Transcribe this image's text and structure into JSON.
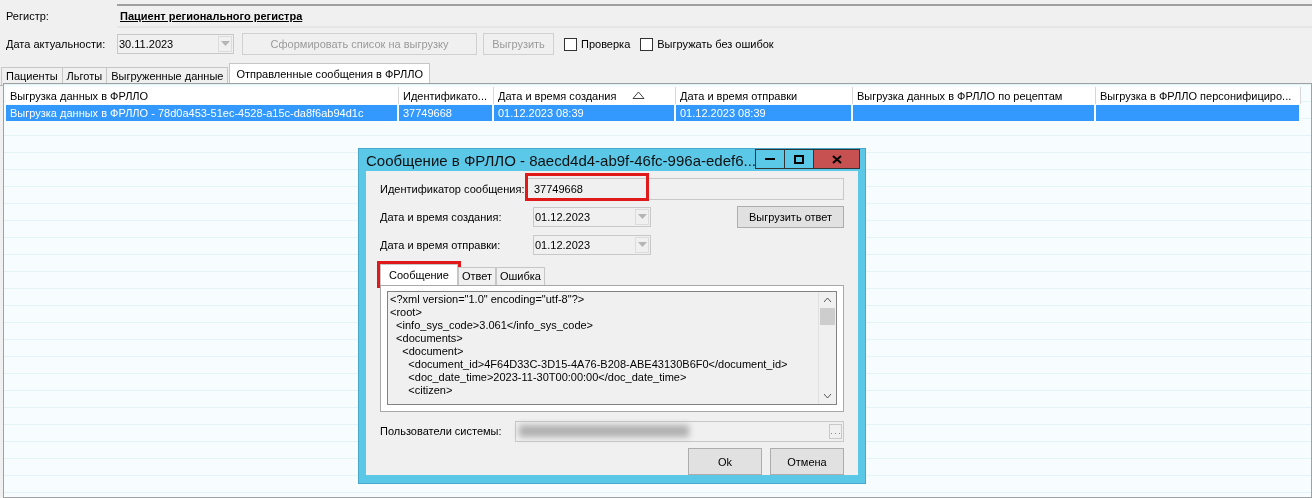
{
  "register": {
    "label": "Регистр:",
    "value": "Пациент регионального регистра"
  },
  "toolbar": {
    "date_label": "Дата актуальности:",
    "date_value": "30.11.2023",
    "buttons": [
      {
        "label": "Сформировать список на выгрузку",
        "disabled": true
      },
      {
        "label": "Выгрузить",
        "disabled": true
      }
    ],
    "checkboxes": [
      {
        "label": "Проверка",
        "checked": false
      },
      {
        "label": "Выгружать без ошибок",
        "checked": false
      }
    ]
  },
  "tabs": [
    {
      "label": "Пациенты",
      "selected": false
    },
    {
      "label": "Льготы",
      "selected": false
    },
    {
      "label": "Выгруженные данные",
      "selected": false
    },
    {
      "label": "Отправленные сообщения в ФРЛЛО",
      "selected": true
    }
  ],
  "table": {
    "columns": [
      {
        "label": "Выгрузка данных в ФРЛЛО",
        "sorted": false
      },
      {
        "label": "Идентификато...",
        "sorted": false
      },
      {
        "label": "Дата и время создания",
        "sorted": true
      },
      {
        "label": "Дата и время отправки",
        "sorted": false
      },
      {
        "label": "Выгрузка данных в ФРЛЛО по рецептам",
        "sorted": false
      },
      {
        "label": "Выгрузка в ФРЛЛО персонифициро...",
        "sorted": false
      }
    ],
    "rows": [
      {
        "selected": true,
        "cells": [
          "Выгрузка данных в ФРЛЛО - 78d0a453-51ec-4528-a15c-da8f6ab94d1c",
          "37749668",
          "01.12.2023 08:39",
          "01.12.2023 08:39",
          "",
          ""
        ]
      }
    ]
  },
  "dialog": {
    "title": "Сообщение в ФРЛЛО - 8aecd4d4-ab9f-46fc-996a-edef6...",
    "fields": [
      {
        "label": "Идентификатор сообщения:",
        "value": "37749668",
        "kind": "text",
        "highlighted": true
      },
      {
        "label": "Дата и время создания:",
        "value": "01.12.2023",
        "kind": "date",
        "highlighted": false
      },
      {
        "label": "Дата и время отправки:",
        "value": "01.12.2023",
        "kind": "date",
        "highlighted": false
      }
    ],
    "export_button": "Выгрузить ответ",
    "tabs": [
      {
        "label": "Сообщение",
        "selected": true,
        "highlighted": true
      },
      {
        "label": "Ответ",
        "selected": false,
        "highlighted": false
      },
      {
        "label": "Ошибка",
        "selected": false,
        "highlighted": false
      }
    ],
    "message_lines": [
      "<?xml version=\"1.0\" encoding=\"utf-8\"?>",
      "<root>",
      "  <info_sys_code>3.061</info_sys_code>",
      "  <documents>",
      "    <document>",
      "      <document_id>4F64D33C-3D15-4A76-B208-ABE43130B6F0</document_id>",
      "      <doc_date_time>2023-11-30T00:00:00</doc_date_time>",
      "      <citizen>"
    ],
    "users_label": "Пользователи системы:",
    "buttons": [
      "Ok",
      "Отмена"
    ]
  }
}
